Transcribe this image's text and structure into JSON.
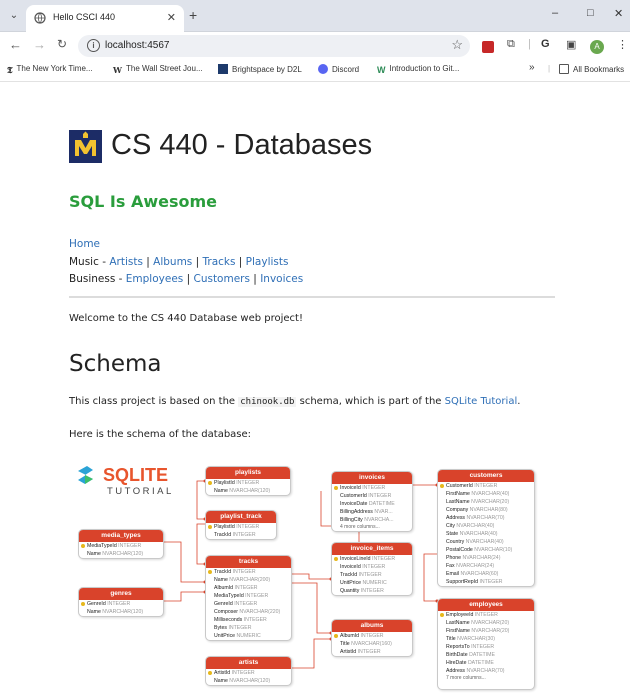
{
  "browser": {
    "tab_title": "Hello CSCI 440",
    "url": "localhost:4567",
    "window_controls": [
      "–",
      "□",
      "✕"
    ],
    "bookmarks": [
      {
        "label": "The New York Time...",
        "icon": "nyt-icon"
      },
      {
        "label": "The Wall Street Jou...",
        "icon": "wsj-icon"
      },
      {
        "label": "Brightspace by D2L",
        "icon": "d2l-icon"
      },
      {
        "label": "Discord",
        "icon": "discord-icon"
      },
      {
        "label": "Introduction to Git...",
        "icon": "git-icon"
      }
    ],
    "bookmarks_overflow": "»",
    "all_bookmarks": "All Bookmarks",
    "profile_initial": "A"
  },
  "page": {
    "title": "CS 440 - Databases",
    "tagline": "SQL Is Awesome",
    "nav": {
      "home": "Home",
      "music_label": "Music",
      "music_links": [
        "Artists",
        "Albums",
        "Tracks",
        "Playlists"
      ],
      "business_label": "Business",
      "business_links": [
        "Employees",
        "Customers",
        "Invoices"
      ]
    },
    "welcome": "Welcome to the CS 440 Database web project!",
    "schema_heading": "Schema",
    "schema_text_before": "This class project is based on the ",
    "schema_code": "chinook.db",
    "schema_text_middle": " schema, which is part of the ",
    "schema_link": "SQLite Tutorial",
    "schema_text_after": ".",
    "schema_intro": "Here is the schema of the database:"
  },
  "diagram": {
    "logo_top": "SQLITE",
    "logo_bottom": "TUTORIAL",
    "accent": "#d9432b",
    "tables": [
      {
        "id": "playlists",
        "name": "playlists",
        "rows": [
          [
            "PlaylistId",
            "INTEGER"
          ],
          [
            "Name",
            "NVARCHAR(120)"
          ]
        ]
      },
      {
        "id": "playlist_track",
        "name": "playlist_track",
        "rows": [
          [
            "PlaylistId",
            "INTEGER"
          ],
          [
            "TrackId",
            "INTEGER"
          ]
        ]
      },
      {
        "id": "media_types",
        "name": "media_types",
        "rows": [
          [
            "MediaTypeId",
            "INTEGER"
          ],
          [
            "Name",
            "NVARCHAR(120)"
          ]
        ]
      },
      {
        "id": "genres",
        "name": "genres",
        "rows": [
          [
            "GenreId",
            "INTEGER"
          ],
          [
            "Name",
            "NVARCHAR(120)"
          ]
        ]
      },
      {
        "id": "tracks",
        "name": "tracks",
        "rows": [
          [
            "TrackId",
            "INTEGER"
          ],
          [
            "Name",
            "NVARCHAR(200)"
          ],
          [
            "AlbumId",
            "INTEGER"
          ],
          [
            "MediaTypeId",
            "INTEGER"
          ],
          [
            "GenreId",
            "INTEGER"
          ],
          [
            "Composer",
            "NVARCHAR(220)"
          ],
          [
            "Milliseconds",
            "INTEGER"
          ],
          [
            "Bytes",
            "INTEGER"
          ],
          [
            "UnitPrice",
            "NUMERIC"
          ]
        ]
      },
      {
        "id": "artists",
        "name": "artists",
        "rows": [
          [
            "ArtistId",
            "INTEGER"
          ],
          [
            "Name",
            "NVARCHAR(120)"
          ]
        ]
      },
      {
        "id": "invoices",
        "name": "invoices",
        "rows": [
          [
            "InvoiceId",
            "INTEGER"
          ],
          [
            "CustomerId",
            "INTEGER"
          ],
          [
            "InvoiceDate",
            "DATETIME"
          ],
          [
            "BillingAddress",
            "NVAR..."
          ],
          [
            "BillingCity",
            "NVARCHA..."
          ]
        ],
        "more": "4 more columns..."
      },
      {
        "id": "invoice_items",
        "name": "invoice_items",
        "rows": [
          [
            "InvoiceLineId",
            "INTEGER"
          ],
          [
            "InvoiceId",
            "INTEGER"
          ],
          [
            "TrackId",
            "INTEGER"
          ],
          [
            "UnitPrice",
            "NUMERIC"
          ],
          [
            "Quantity",
            "INTEGER"
          ]
        ]
      },
      {
        "id": "albums",
        "name": "albums",
        "rows": [
          [
            "AlbumId",
            "INTEGER"
          ],
          [
            "Title",
            "NVARCHAR(160)"
          ],
          [
            "ArtistId",
            "INTEGER"
          ]
        ]
      },
      {
        "id": "customers",
        "name": "customers",
        "rows": [
          [
            "CustomerId",
            "INTEGER"
          ],
          [
            "FirstName",
            "NVARCHAR(40)"
          ],
          [
            "LastName",
            "NVARCHAR(20)"
          ],
          [
            "Company",
            "NVARCHAR(80)"
          ],
          [
            "Address",
            "NVARCHAR(70)"
          ],
          [
            "City",
            "NVARCHAR(40)"
          ],
          [
            "State",
            "NVARCHAR(40)"
          ],
          [
            "Country",
            "NVARCHAR(40)"
          ],
          [
            "PostalCode",
            "NVARCHAR(10)"
          ],
          [
            "Phone",
            "NVARCHAR(24)"
          ],
          [
            "Fax",
            "NVARCHAR(24)"
          ],
          [
            "Email",
            "NVARCHAR(60)"
          ],
          [
            "SupportRepId",
            "INTEGER"
          ]
        ]
      },
      {
        "id": "employees",
        "name": "employees",
        "rows": [
          [
            "EmployeeId",
            "INTEGER"
          ],
          [
            "LastName",
            "NVARCHAR(20)"
          ],
          [
            "FirstName",
            "NVARCHAR(20)"
          ],
          [
            "Title",
            "NVARCHAR(30)"
          ],
          [
            "ReportsTo",
            "INTEGER"
          ],
          [
            "BirthDate",
            "DATETIME"
          ],
          [
            "HireDate",
            "DATETIME"
          ],
          [
            "Address",
            "NVARCHAR(70)"
          ]
        ],
        "more": "7 more columns..."
      }
    ]
  }
}
